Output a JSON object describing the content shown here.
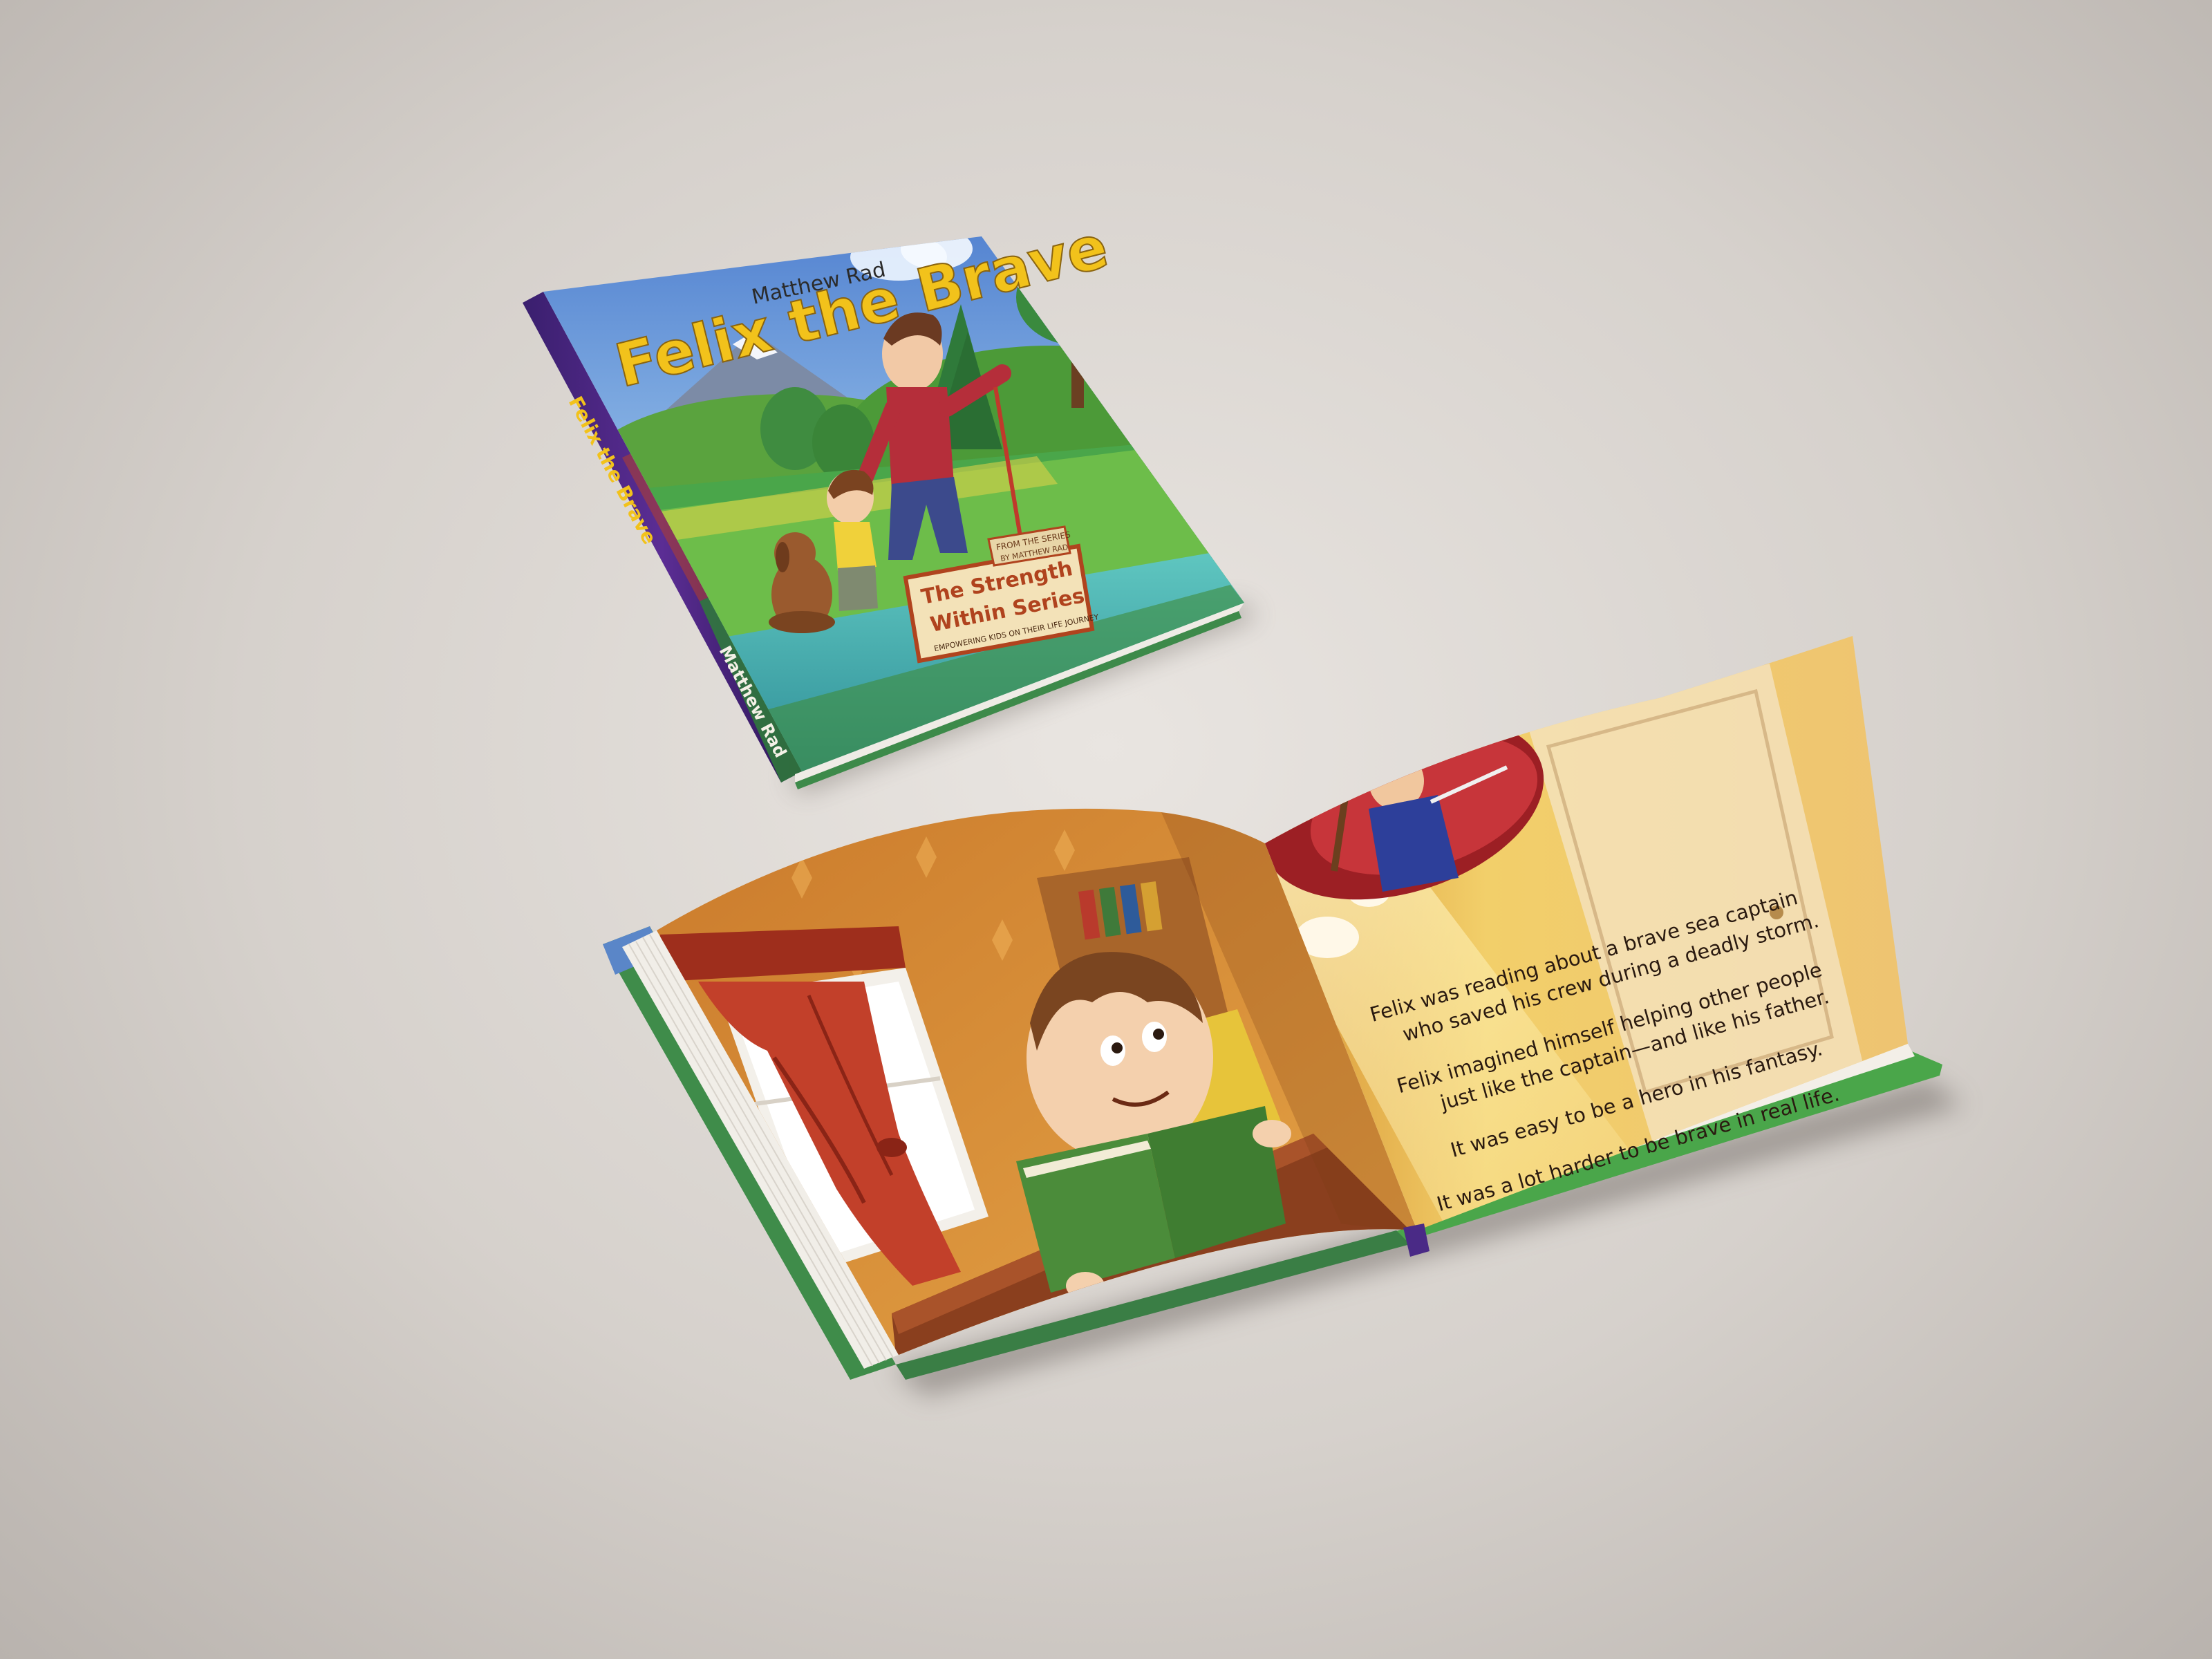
{
  "closed_book": {
    "cover": {
      "author": "Matthew Rad",
      "title": "Felix the Brave",
      "badge": {
        "top_line_1": "FROM THE SERIES",
        "top_line_2": "BY MATTHEW RAD",
        "series_line_1": "The Strength",
        "series_line_2": "Within Series",
        "tagline": "EMPOWERING KIDS ON THEIR LIFE JOURNEY"
      }
    },
    "spine": {
      "title": "Felix the Brave",
      "author": "Matthew Rad"
    }
  },
  "open_book": {
    "right_page": {
      "paragraphs": [
        "Felix was reading about a brave sea captain",
        "who saved his crew during a deadly storm.",
        "Felix imagined himself helping other people",
        "just like the captain—and like his father.",
        "It was easy to be a hero in his fantasy.",
        "It was a lot harder to be brave in real life."
      ]
    }
  },
  "colors": {
    "backdrop": "#d9d4cf",
    "spine_purple": "#4a2a86",
    "cover_sky": "#6f9fd6",
    "cover_grass": "#4aa64a",
    "title_yellow": "#f2c21b",
    "page_orange": "#d98a2c",
    "curtain_red": "#b83a22"
  }
}
